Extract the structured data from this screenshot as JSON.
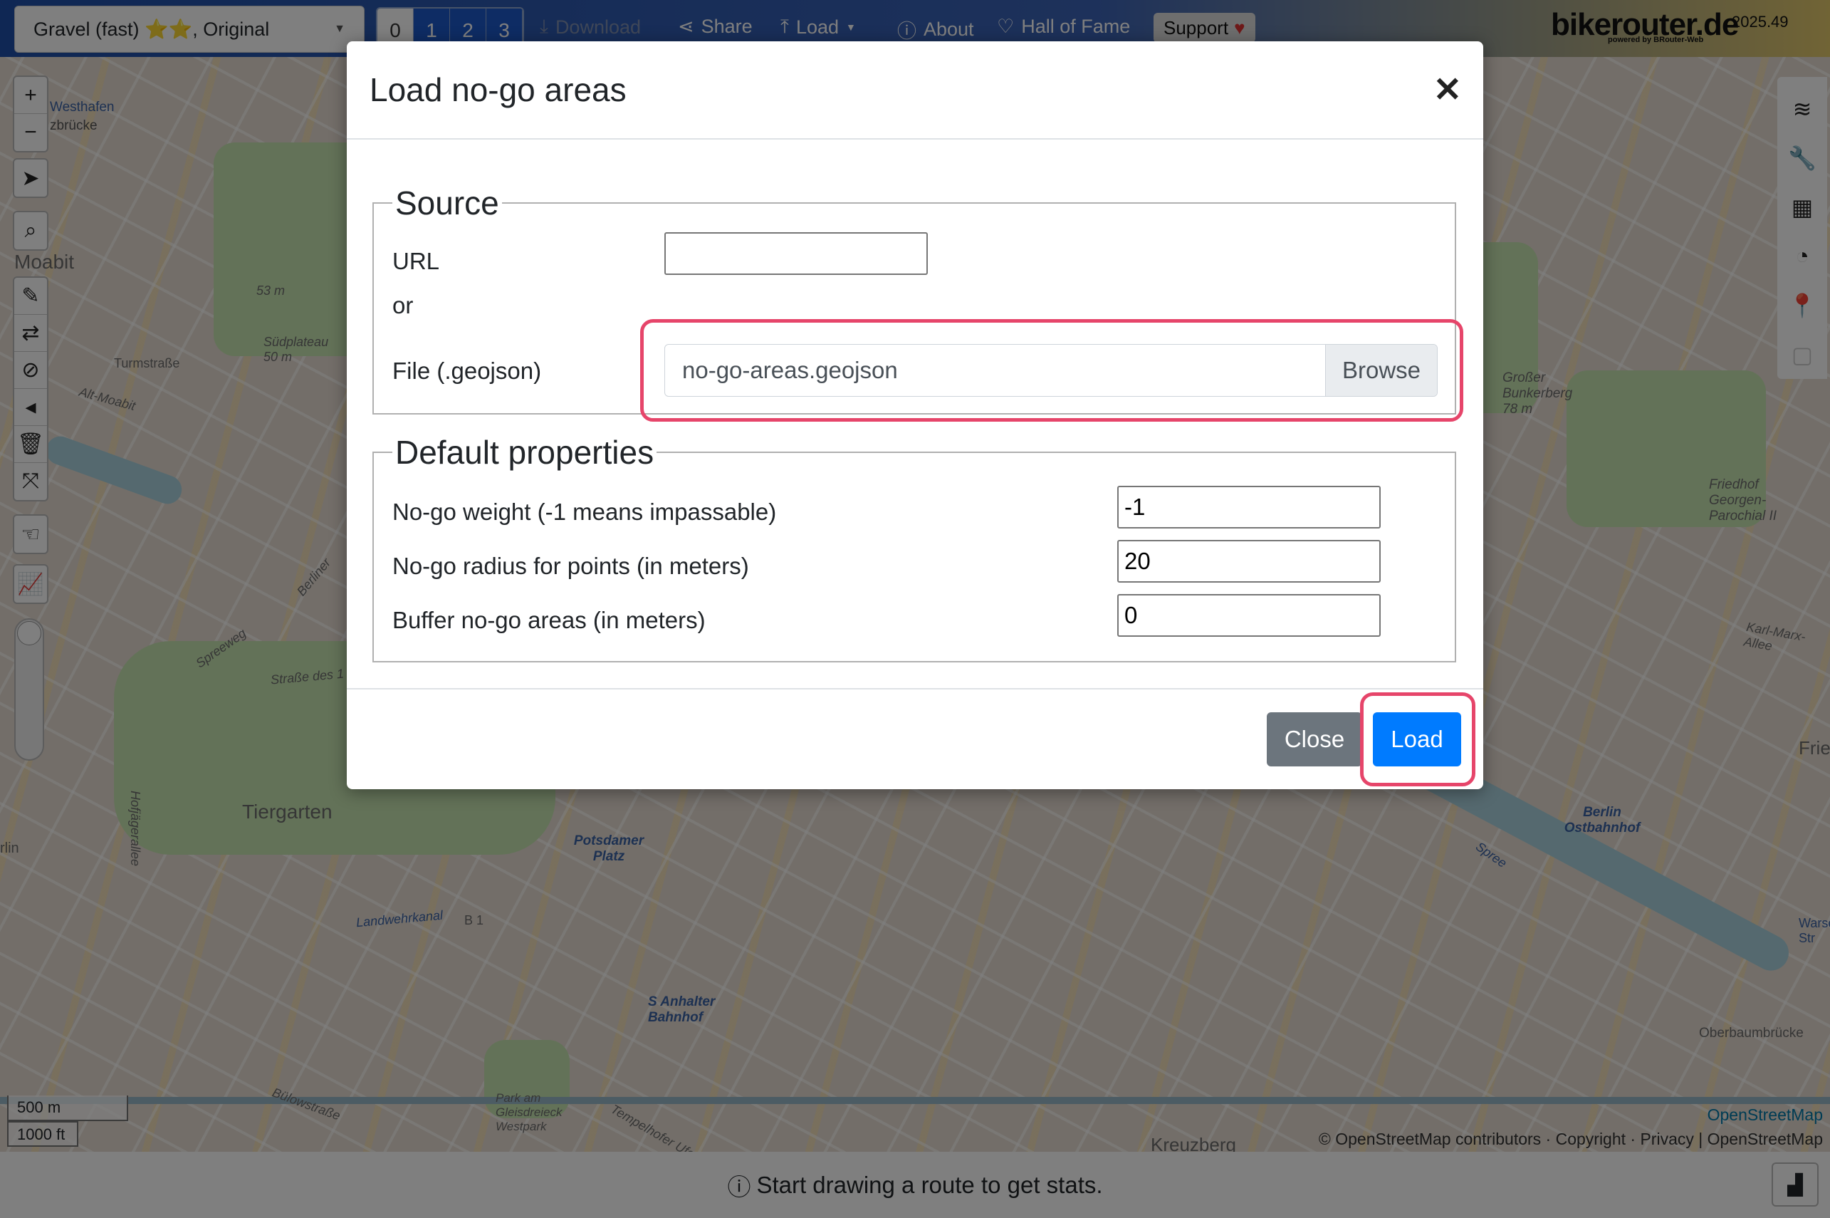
{
  "topbar": {
    "profile": "Gravel (fast) ⭐⭐, Original",
    "alternatives": [
      "0",
      "1",
      "2",
      "3"
    ],
    "download": "Download",
    "share": "Share",
    "load": "Load",
    "about": "About",
    "hall_of_fame": "Hall of Fame",
    "support": "Support",
    "brand": "bikerouter.de",
    "brand_sub": "powered by BRouter-Web",
    "version": "2025.49"
  },
  "map": {
    "labels": [
      "Moabit",
      "Tiergarten",
      "Potsdamer Platz",
      "Berlin Ostbahnhof",
      "Großer Bunkerberg 78 m",
      "Oberbaumbrücke",
      "Kreuzberg",
      "S Anhalter Bahnhof",
      "Friedhof Georgen-Parochial II",
      "Alt-Moabit",
      "Turmstraße",
      "Hofjägerallee",
      "Spreeweg",
      "Karl-Marx-Allee",
      "Landwehrkanal",
      "Bülowstraße",
      "Südplateau 50 m",
      "53 m",
      "Friedr",
      "Warsc Str",
      "Westhafen",
      "zbrücke",
      "rlin",
      "Park am Gleisdreieck Westpark",
      "B 1",
      "Tempelhofer Ufer",
      "Straße des 1",
      "Berliner",
      "Spree"
    ],
    "scale_metric": "500 m",
    "scale_imperial": "1000 ft",
    "attribution_top": "OpenStreetMap",
    "attribution": "© OpenStreetMap contributors · Copyright · Privacy | OpenStreetMap"
  },
  "modal": {
    "title": "Load no-go areas",
    "source_legend": "Source",
    "url_label": "URL",
    "url_value": "",
    "or_label": "or",
    "file_label": "File (.geojson)",
    "file_name": "no-go-areas.geojson",
    "browse_label": "Browse",
    "defaults_legend": "Default properties",
    "weight_label": "No-go weight (-1 means impassable)",
    "weight_value": "-1",
    "radius_label": "No-go radius for points (in meters)",
    "radius_value": "20",
    "buffer_label": "Buffer no-go areas (in meters)",
    "buffer_value": "0",
    "close_button": "Close",
    "load_button": "Load"
  },
  "status": {
    "message": "Start drawing a route to get stats."
  },
  "highlight_color": "#e6456a",
  "accent_color": "#007bff"
}
